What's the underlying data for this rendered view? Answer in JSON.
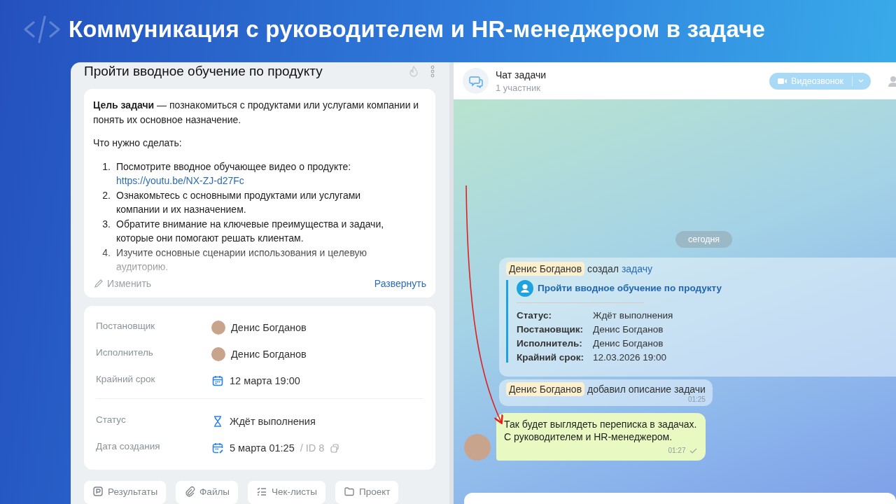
{
  "banner": {
    "title": "Коммуникация с руководителем и HR-менеджером в задаче"
  },
  "task": {
    "title": "Пройти вводное обучение по продукту",
    "description": {
      "intro": "**Цель задачи** — познакомиться с продуктами или услугами компании и понять их основное назначение.",
      "todo_label": "Что нужно сделать:",
      "steps": [
        {
          "number": "1.",
          "text": "Посмотрите вводное обучающее видео о продукте:",
          "link": "https://youtu.be/NX-ZJ-d27Fc"
        },
        {
          "number": "2.",
          "text": "Ознакомьтесь с основными продуктами или услугами компании и их назначением."
        },
        {
          "number": "3.",
          "text": "Обратите внимание на ключевые преимущества и задачи, которые они помогают решать клиентам."
        },
        {
          "number": "4.",
          "text": "Изучите основные сценарии использования и целевую аудиторию."
        }
      ],
      "edit": "Изменить",
      "expand": "Развернуть"
    },
    "field_groups": [
      {
        "fields": [
          {
            "kind": "person",
            "label": "Постановщик",
            "value": "Денис Богданов"
          },
          {
            "kind": "person",
            "label": "Исполнитель",
            "value": "Денис Богданов"
          },
          {
            "kind": "deadline",
            "label": "Крайний срок",
            "value": "12 марта 19:00"
          }
        ]
      },
      {
        "fields": [
          {
            "kind": "status",
            "label": "Статус",
            "value": "Ждёт выполнения"
          },
          {
            "kind": "created",
            "label": "Дата создания",
            "value": "5 марта 01:25",
            "id": "/ ID 8"
          }
        ]
      }
    ],
    "tabs": [
      {
        "kind": "results",
        "label": "Результаты"
      },
      {
        "kind": "files",
        "label": "Файлы"
      },
      {
        "kind": "checklists",
        "label": "Чек-листы"
      },
      {
        "kind": "project",
        "label": "Проект"
      }
    ]
  },
  "chat": {
    "title": "Чат задачи",
    "subtitle": "1 участник",
    "video_button": "Видеозвонок",
    "date_separator": "сегодня",
    "messages": [
      {
        "kind": "task_created",
        "author": "Денис Богданов",
        "action": "создал",
        "link": "задачу",
        "task_title": "Пройти вводное обучение по продукту",
        "details": [
          {
            "label": "Статус:",
            "value": "Ждёт выполнения"
          },
          {
            "label": "Постановщик:",
            "value": "Денис Богданов"
          },
          {
            "label": "Исполнитель:",
            "value": "Денис Богданов"
          },
          {
            "label": "Крайний срок:",
            "value": "12.03.2026 19:00"
          }
        ]
      },
      {
        "kind": "event",
        "author": "Денис Богданов",
        "action": "добавил описание задачи",
        "time": "01:25"
      },
      {
        "kind": "text",
        "lines": [
          "Так будет выглядеть переписка в задачах.",
          "С руководителем и HR-менеджером."
        ],
        "time": "01:27"
      }
    ]
  }
}
